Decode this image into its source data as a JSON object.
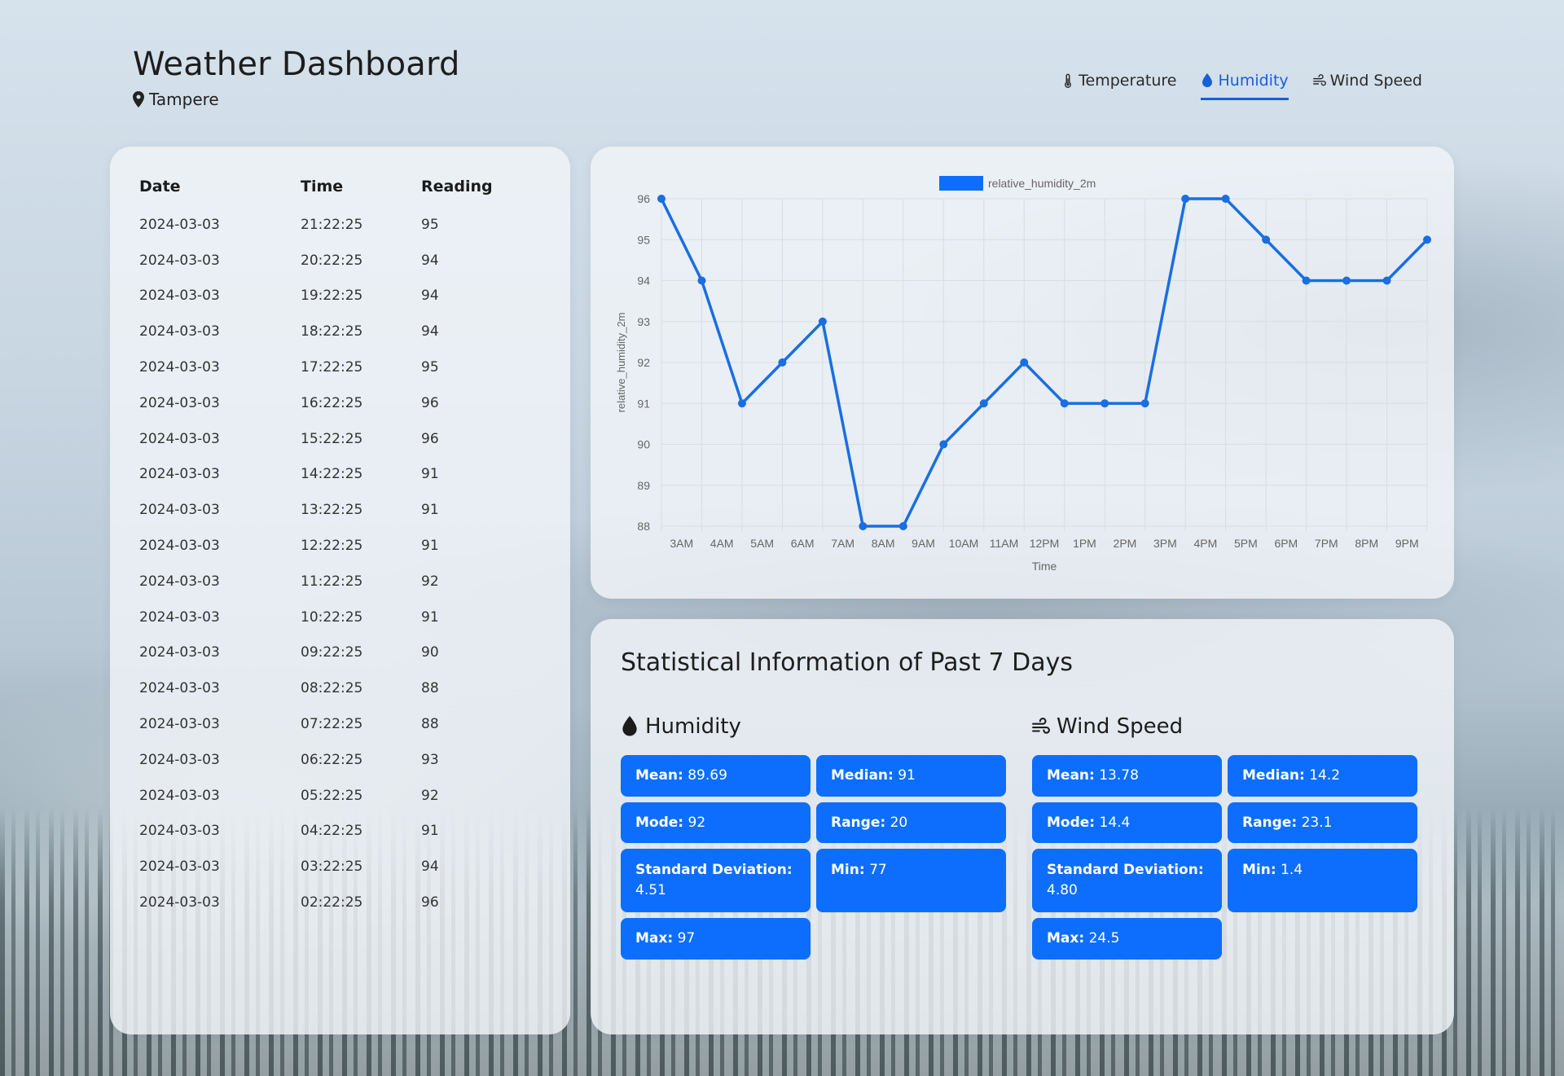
{
  "app": {
    "title": "Weather Dashboard",
    "location": "Tampere"
  },
  "tabs": [
    {
      "label": "Temperature",
      "icon": "thermometer-icon",
      "active": false
    },
    {
      "label": "Humidity",
      "icon": "droplet-icon",
      "active": true
    },
    {
      "label": "Wind Speed",
      "icon": "wind-icon",
      "active": false
    }
  ],
  "colors": {
    "accent": "#1660d8",
    "stat_bg": "#0d6efd",
    "line": "#1a6ee0"
  },
  "table": {
    "headers": {
      "date": "Date",
      "time": "Time",
      "reading": "Reading"
    },
    "rows": [
      {
        "date": "2024-03-03",
        "time": "21:22:25",
        "reading": "95"
      },
      {
        "date": "2024-03-03",
        "time": "20:22:25",
        "reading": "94"
      },
      {
        "date": "2024-03-03",
        "time": "19:22:25",
        "reading": "94"
      },
      {
        "date": "2024-03-03",
        "time": "18:22:25",
        "reading": "94"
      },
      {
        "date": "2024-03-03",
        "time": "17:22:25",
        "reading": "95"
      },
      {
        "date": "2024-03-03",
        "time": "16:22:25",
        "reading": "96"
      },
      {
        "date": "2024-03-03",
        "time": "15:22:25",
        "reading": "96"
      },
      {
        "date": "2024-03-03",
        "time": "14:22:25",
        "reading": "91"
      },
      {
        "date": "2024-03-03",
        "time": "13:22:25",
        "reading": "91"
      },
      {
        "date": "2024-03-03",
        "time": "12:22:25",
        "reading": "91"
      },
      {
        "date": "2024-03-03",
        "time": "11:22:25",
        "reading": "92"
      },
      {
        "date": "2024-03-03",
        "time": "10:22:25",
        "reading": "91"
      },
      {
        "date": "2024-03-03",
        "time": "09:22:25",
        "reading": "90"
      },
      {
        "date": "2024-03-03",
        "time": "08:22:25",
        "reading": "88"
      },
      {
        "date": "2024-03-03",
        "time": "07:22:25",
        "reading": "88"
      },
      {
        "date": "2024-03-03",
        "time": "06:22:25",
        "reading": "93"
      },
      {
        "date": "2024-03-03",
        "time": "05:22:25",
        "reading": "92"
      },
      {
        "date": "2024-03-03",
        "time": "04:22:25",
        "reading": "91"
      },
      {
        "date": "2024-03-03",
        "time": "03:22:25",
        "reading": "94"
      },
      {
        "date": "2024-03-03",
        "time": "02:22:25",
        "reading": "96"
      }
    ]
  },
  "chart_data": {
    "type": "line",
    "legend": "relative_humidity_2m",
    "legend_position": "top",
    "xlabel": "Time",
    "ylabel": "relative_humidity_2m",
    "x_ticks": [
      "3AM",
      "4AM",
      "5AM",
      "6AM",
      "7AM",
      "8AM",
      "9AM",
      "10AM",
      "11AM",
      "12PM",
      "1PM",
      "2PM",
      "3PM",
      "4PM",
      "5PM",
      "6PM",
      "7PM",
      "8PM",
      "9PM"
    ],
    "ylim": [
      88,
      96
    ],
    "y_ticks": [
      88,
      89,
      90,
      91,
      92,
      93,
      94,
      95,
      96
    ],
    "grid": true,
    "series": [
      {
        "name": "relative_humidity_2m",
        "x": [
          "02:22",
          "03:22",
          "04:22",
          "05:22",
          "06:22",
          "07:22",
          "08:22",
          "09:22",
          "10:22",
          "11:22",
          "12:22",
          "13:22",
          "14:22",
          "15:22",
          "16:22",
          "17:22",
          "18:22",
          "19:22",
          "20:22",
          "21:22"
        ],
        "values": [
          96,
          94,
          91,
          92,
          93,
          88,
          88,
          90,
          91,
          92,
          91,
          91,
          91,
          96,
          96,
          95,
          94,
          94,
          94,
          95
        ]
      }
    ]
  },
  "stats": {
    "title": "Statistical Information of Past 7 Days",
    "groups": [
      {
        "title": "Humidity",
        "items": [
          {
            "label": "Mean:",
            "value": "89.69"
          },
          {
            "label": "Median:",
            "value": "91"
          },
          {
            "label": "Mode:",
            "value": "92"
          },
          {
            "label": "Range:",
            "value": "20"
          },
          {
            "label": "Standard Deviation:",
            "value": "4.51"
          },
          {
            "label": "Min:",
            "value": "77"
          },
          {
            "label": "Max:",
            "value": "97"
          }
        ]
      },
      {
        "title": "Wind Speed",
        "items": [
          {
            "label": "Mean:",
            "value": "13.78"
          },
          {
            "label": "Median:",
            "value": "14.2"
          },
          {
            "label": "Mode:",
            "value": "14.4"
          },
          {
            "label": "Range:",
            "value": "23.1"
          },
          {
            "label": "Standard Deviation:",
            "value": "4.80"
          },
          {
            "label": "Min:",
            "value": "1.4"
          },
          {
            "label": "Max:",
            "value": "24.5"
          }
        ]
      }
    ]
  }
}
